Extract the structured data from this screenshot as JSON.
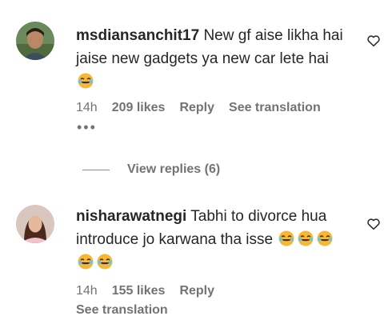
{
  "comments": [
    {
      "username": "msdiansanchit17",
      "text_parts": [
        "New gf aise likha hai jaise new gadgets ya new car lete hai "
      ],
      "time": "14h",
      "likes": "209 likes",
      "reply": "Reply",
      "see_translation": "See translation",
      "more": "•••",
      "view_replies": "View replies (6)"
    },
    {
      "username": "nisharawatnegi",
      "text_parts": [
        "Tabhi to divorce hua introduce jo karwana tha isse "
      ],
      "time": "14h",
      "likes": "155 likes",
      "reply": "Reply",
      "see_translation": "See translation"
    }
  ],
  "icons": {
    "heart": "heart-outline-icon",
    "emoji": "face-with-tears-of-joy-emoji"
  },
  "colors": {
    "text": "#262626",
    "secondary": "#737373",
    "emoji": "#f7b731"
  }
}
